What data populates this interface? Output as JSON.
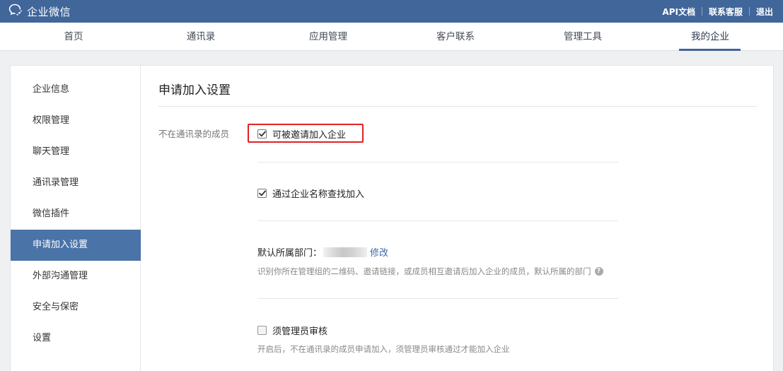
{
  "app": {
    "title": "企业微信"
  },
  "top_links": [
    {
      "label": "API文档"
    },
    {
      "label": "联系客服"
    },
    {
      "label": "退出"
    }
  ],
  "nav": {
    "tabs": [
      {
        "label": "首页"
      },
      {
        "label": "通讯录"
      },
      {
        "label": "应用管理"
      },
      {
        "label": "客户联系"
      },
      {
        "label": "管理工具"
      },
      {
        "label": "我的企业"
      }
    ],
    "active": "我的企业"
  },
  "sidebar": {
    "items": [
      {
        "label": "企业信息"
      },
      {
        "label": "权限管理"
      },
      {
        "label": "聊天管理"
      },
      {
        "label": "通讯录管理"
      },
      {
        "label": "微信插件"
      },
      {
        "label": "申请加入设置"
      },
      {
        "label": "外部沟通管理"
      },
      {
        "label": "安全与保密"
      },
      {
        "label": "设置"
      }
    ],
    "active": "申请加入设置"
  },
  "main": {
    "title": "申请加入设置",
    "row_label": "不在通讯录的成员",
    "invite": {
      "label": "可被邀请加入企业",
      "checked": true
    },
    "search": {
      "label": "通过企业名称查找加入",
      "checked": true
    },
    "dept": {
      "label": "默认所属部门：",
      "edit_label": "修改",
      "hint": "识别你所在管理组的二维码、邀请链接，或成员相互邀请后加入企业的成员，默认所属的部门",
      "help": "?"
    },
    "review": {
      "label": "须管理员审核",
      "checked": false,
      "hint": "开启后，不在通讯录的成员申请加入，须管理员审核通过才能加入企业"
    }
  },
  "colors": {
    "topbar": "#40669a",
    "sidebar_active": "#4a73a8",
    "link": "#3c6aa6",
    "highlight": "#e02222"
  }
}
